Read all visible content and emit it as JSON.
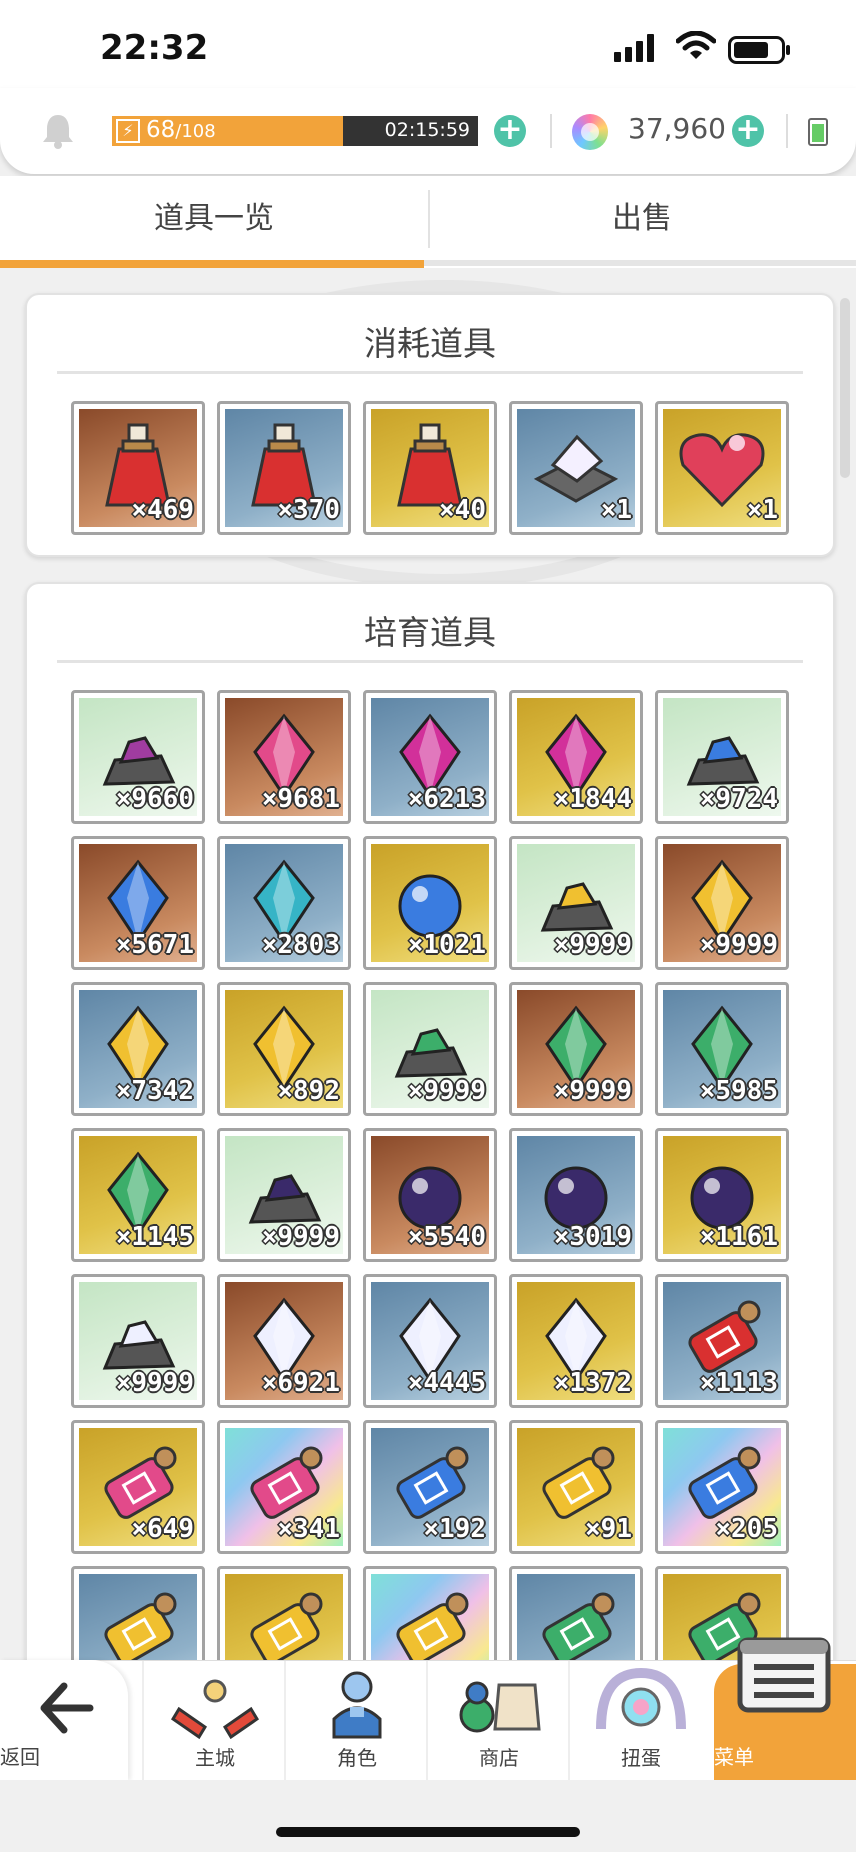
{
  "status_bar": {
    "time": "22:32"
  },
  "top_bar": {
    "stamina_current": "68",
    "stamina_max": "/108",
    "stamina_fraction": 0.63,
    "stamina_timer": "02:15:59",
    "gems": "37,960"
  },
  "tabs": [
    {
      "label": "道具一览",
      "active": true
    },
    {
      "label": "出售",
      "active": false
    }
  ],
  "consumables": {
    "title": "消耗道具",
    "items": [
      {
        "icon": "red-potion-small",
        "bg": "brown",
        "qty": "×469"
      },
      {
        "icon": "red-potion-medium",
        "bg": "blue",
        "qty": "×370"
      },
      {
        "icon": "red-potion-large",
        "bg": "gold",
        "qty": "×40"
      },
      {
        "icon": "gem-box",
        "bg": "blue",
        "qty": "×1"
      },
      {
        "icon": "gift-heart",
        "bg": "gold",
        "qty": "×1"
      }
    ]
  },
  "training": {
    "title": "培育道具",
    "items": [
      {
        "icon": "purple-ore",
        "bg": "green",
        "qty": "×9660"
      },
      {
        "icon": "pink-gem",
        "bg": "brown",
        "qty": "×9681"
      },
      {
        "icon": "magenta-crystal",
        "bg": "blue",
        "qty": "×6213"
      },
      {
        "icon": "magenta-diamond",
        "bg": "gold",
        "qty": "×1844"
      },
      {
        "icon": "blue-ore",
        "bg": "green",
        "qty": "×9724"
      },
      {
        "icon": "blue-crystal-shard",
        "bg": "brown",
        "qty": "×5671"
      },
      {
        "icon": "teal-crystal",
        "bg": "blue",
        "qty": "×2803"
      },
      {
        "icon": "blue-orb",
        "bg": "gold",
        "qty": "×1021"
      },
      {
        "icon": "gold-ore",
        "bg": "green",
        "qty": "×9999"
      },
      {
        "icon": "gold-nugget",
        "bg": "brown",
        "qty": "×9999"
      },
      {
        "icon": "amber-gem",
        "bg": "blue",
        "qty": "×7342"
      },
      {
        "icon": "amber-crest",
        "bg": "gold",
        "qty": "×892"
      },
      {
        "icon": "green-ore",
        "bg": "green",
        "qty": "×9999"
      },
      {
        "icon": "green-crystal-cluster",
        "bg": "brown",
        "qty": "×9999"
      },
      {
        "icon": "emerald-gem",
        "bg": "blue",
        "qty": "×5985"
      },
      {
        "icon": "emerald-hat",
        "bg": "gold",
        "qty": "×1145"
      },
      {
        "icon": "dark-ore",
        "bg": "green",
        "qty": "×9999"
      },
      {
        "icon": "dark-orb-small",
        "bg": "brown",
        "qty": "×5540"
      },
      {
        "icon": "dark-orb",
        "bg": "blue",
        "qty": "×3019"
      },
      {
        "icon": "dark-winged-orb",
        "bg": "gold",
        "qty": "×1161"
      },
      {
        "icon": "white-ore",
        "bg": "green",
        "qty": "×9999"
      },
      {
        "icon": "white-crystal",
        "bg": "brown",
        "qty": "×6921"
      },
      {
        "icon": "white-diamond",
        "bg": "blue",
        "qty": "×4445"
      },
      {
        "icon": "white-winged-crystal",
        "bg": "gold",
        "qty": "×1372"
      },
      {
        "icon": "red-scroll",
        "bg": "blue",
        "qty": "×1113"
      },
      {
        "icon": "pink-scroll",
        "bg": "gold",
        "qty": "×649"
      },
      {
        "icon": "pink-scroll-large",
        "bg": "rainbow",
        "qty": "×341"
      },
      {
        "icon": "blue-scroll",
        "bg": "blue",
        "qty": "×192"
      },
      {
        "icon": "blue-scroll-gold",
        "bg": "gold",
        "qty": "×91"
      },
      {
        "icon": "blue-scroll-large",
        "bg": "rainbow",
        "qty": "×205"
      },
      {
        "icon": "yellow-scroll",
        "bg": "blue",
        "qty": ""
      },
      {
        "icon": "yellow-scroll-gold",
        "bg": "gold",
        "qty": ""
      },
      {
        "icon": "yellow-scroll-large",
        "bg": "rainbow",
        "qty": ""
      },
      {
        "icon": "green-scroll",
        "bg": "blue",
        "qty": ""
      },
      {
        "icon": "green-scroll-gold",
        "bg": "gold",
        "qty": ""
      }
    ]
  },
  "nav": {
    "back": "返回",
    "items": [
      {
        "label": "主城",
        "icon": "castle-icon"
      },
      {
        "label": "角色",
        "icon": "character-icon"
      },
      {
        "label": "商店",
        "icon": "shop-icon"
      },
      {
        "label": "扭蛋",
        "icon": "gacha-icon"
      },
      {
        "label": "菜单",
        "icon": "menu-icon",
        "active": true
      }
    ]
  },
  "colors": {
    "accent": "#f2a33a",
    "plus": "#4fc3a8",
    "bg_brown": "#b4693e",
    "bg_blue": "#6f96b4",
    "bg_gold": "#d8b532",
    "bg_green": "#cde9cc"
  }
}
